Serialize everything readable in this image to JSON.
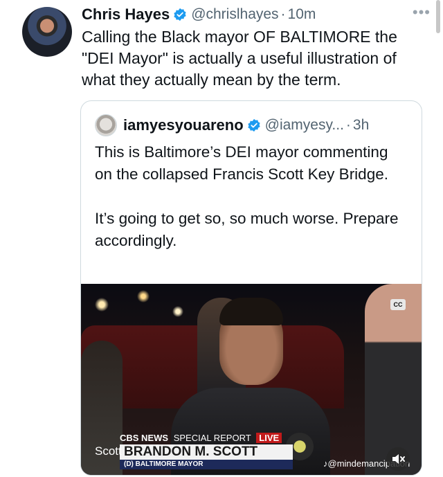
{
  "tweet": {
    "author_name": "Chris Hayes",
    "handle": "@chrislhayes",
    "separator": "·",
    "time": "10m",
    "more_icon": "more-horizontal-icon",
    "text": "Calling the Black mayor OF BALTIMORE the \"DEI Mayor\" is actually a useful illustration of what they actually mean by the term."
  },
  "quote": {
    "author_name": "iamyesyouareno",
    "handle": "@iamyesy...",
    "separator": "·",
    "time": "3h",
    "text_1": "This is Baltimore’s DEI mayor commenting on the collapsed Francis Scott Key Bridge.",
    "text_2": "It’s going to get so, so much worse. Prepare accordingly."
  },
  "video": {
    "cc_label": "CC",
    "network": "CBS NEWS",
    "special": "SPECIAL REPORT",
    "live": "LIVE",
    "caption": "Scott",
    "nameplate": "BRANDON M. SCOTT",
    "title": "(D) BALTIMORE MAYOR",
    "watermark": "@mindemancipation",
    "mute_icon": "speaker-muted-icon"
  },
  "colors": {
    "verified": "#1d9bf0",
    "text": "#0f1419",
    "secondary": "#536471",
    "border": "#cfd9de"
  }
}
